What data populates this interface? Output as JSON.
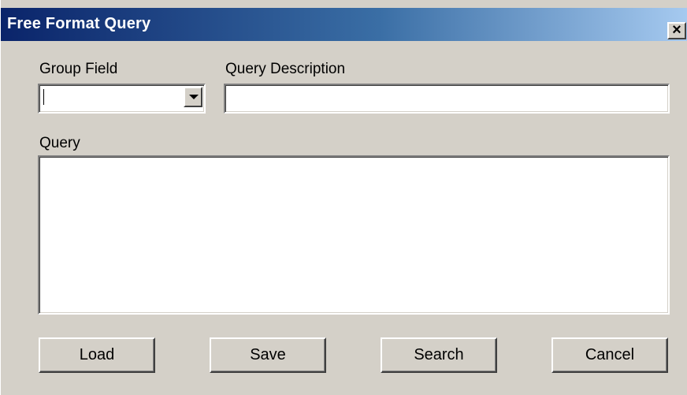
{
  "window": {
    "title": "Free Format Query",
    "close_label": "×"
  },
  "form": {
    "group_field_label": "Group Field",
    "group_field_value": "",
    "query_description_label": "Query Description",
    "query_description_value": "",
    "query_label": "Query",
    "query_value": ""
  },
  "buttons": {
    "load": "Load",
    "save": "Save",
    "search": "Search",
    "cancel": "Cancel"
  }
}
